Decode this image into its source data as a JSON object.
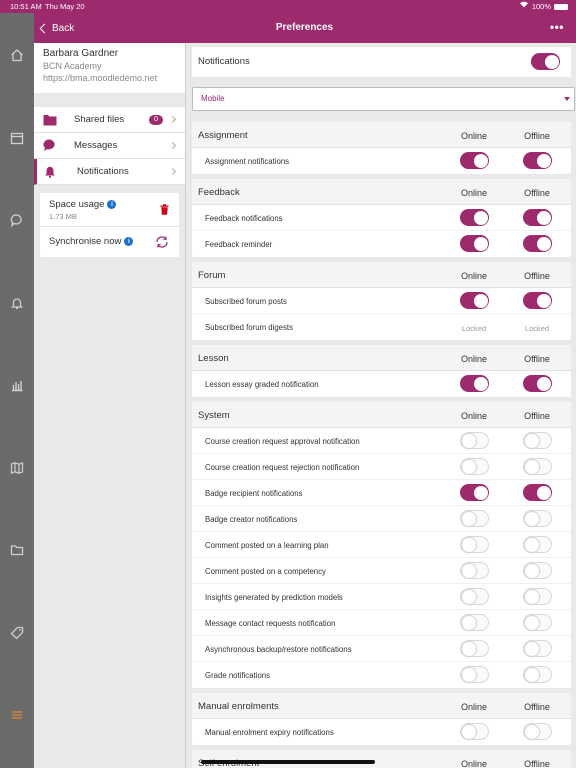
{
  "status": {
    "time": "10:51 AM",
    "date": "Thu May 20",
    "battery": "100%"
  },
  "header": {
    "back_label": "Back",
    "title": "Preferences",
    "more_icon": "more-horizontal-icon"
  },
  "rail": {
    "icons": [
      "home-icon",
      "calendar-icon",
      "chat-icon",
      "bell-icon",
      "chart-icon",
      "map-icon",
      "folder-icon",
      "tag-icon",
      "menu-icon"
    ]
  },
  "user": {
    "name": "Barbara Gardner",
    "institution": "BCN Academy",
    "url": "https://bma.moodledemo.net"
  },
  "menu": [
    {
      "label": "Shared files",
      "badge": "0",
      "icon": "folder-icon"
    },
    {
      "label": "Messages",
      "icon": "chat-icon"
    },
    {
      "label": "Notifications",
      "icon": "bell-icon",
      "active": true
    }
  ],
  "storage": {
    "space_label": "Space usage",
    "space_value": "1.73 MB",
    "sync_label": "Synchronise now"
  },
  "notifications_toggle": {
    "label": "Notifications",
    "on": true
  },
  "processor": {
    "selected": "Mobile"
  },
  "col_online": "Online",
  "col_offline": "Offline",
  "locked_label": "Locked",
  "sections": [
    {
      "title": "Assignment",
      "items": [
        {
          "label": "Assignment notifications",
          "online": "on",
          "offline": "on"
        }
      ]
    },
    {
      "title": "Feedback",
      "items": [
        {
          "label": "Feedback notifications",
          "online": "on",
          "offline": "on"
        },
        {
          "label": "Feedback reminder",
          "online": "on",
          "offline": "on"
        }
      ]
    },
    {
      "title": "Forum",
      "items": [
        {
          "label": "Subscribed forum posts",
          "online": "on",
          "offline": "on"
        },
        {
          "label": "Subscribed forum digests",
          "online": "locked",
          "offline": "locked"
        }
      ]
    },
    {
      "title": "Lesson",
      "items": [
        {
          "label": "Lesson essay graded notification",
          "online": "on",
          "offline": "on"
        }
      ]
    },
    {
      "title": "System",
      "items": [
        {
          "label": "Course creation request approval notification",
          "online": "off",
          "offline": "off"
        },
        {
          "label": "Course creation request rejection notification",
          "online": "off",
          "offline": "off"
        },
        {
          "label": "Badge recipient notifications",
          "online": "on",
          "offline": "on"
        },
        {
          "label": "Badge creator notifications",
          "online": "off",
          "offline": "off"
        },
        {
          "label": "Comment posted on a learning plan",
          "online": "off",
          "offline": "off"
        },
        {
          "label": "Comment posted on a competency",
          "online": "off",
          "offline": "off"
        },
        {
          "label": "Insights generated by prediction models",
          "online": "off",
          "offline": "off"
        },
        {
          "label": "Message contact requests notification",
          "online": "off",
          "offline": "off"
        },
        {
          "label": "Asynchronous backup/restore notifications",
          "online": "off",
          "offline": "off"
        },
        {
          "label": "Grade notifications",
          "online": "off",
          "offline": "off"
        }
      ]
    },
    {
      "title": "Manual enrolments",
      "items": [
        {
          "label": "Manual enrolment expiry notifications",
          "online": "off",
          "offline": "off"
        }
      ]
    },
    {
      "title": "Self enrolment",
      "items": []
    }
  ],
  "colors": {
    "accent": "#9c2a6c",
    "rail": "#6b6b6b",
    "info": "#1a6fd0",
    "delete": "#d0021b"
  }
}
